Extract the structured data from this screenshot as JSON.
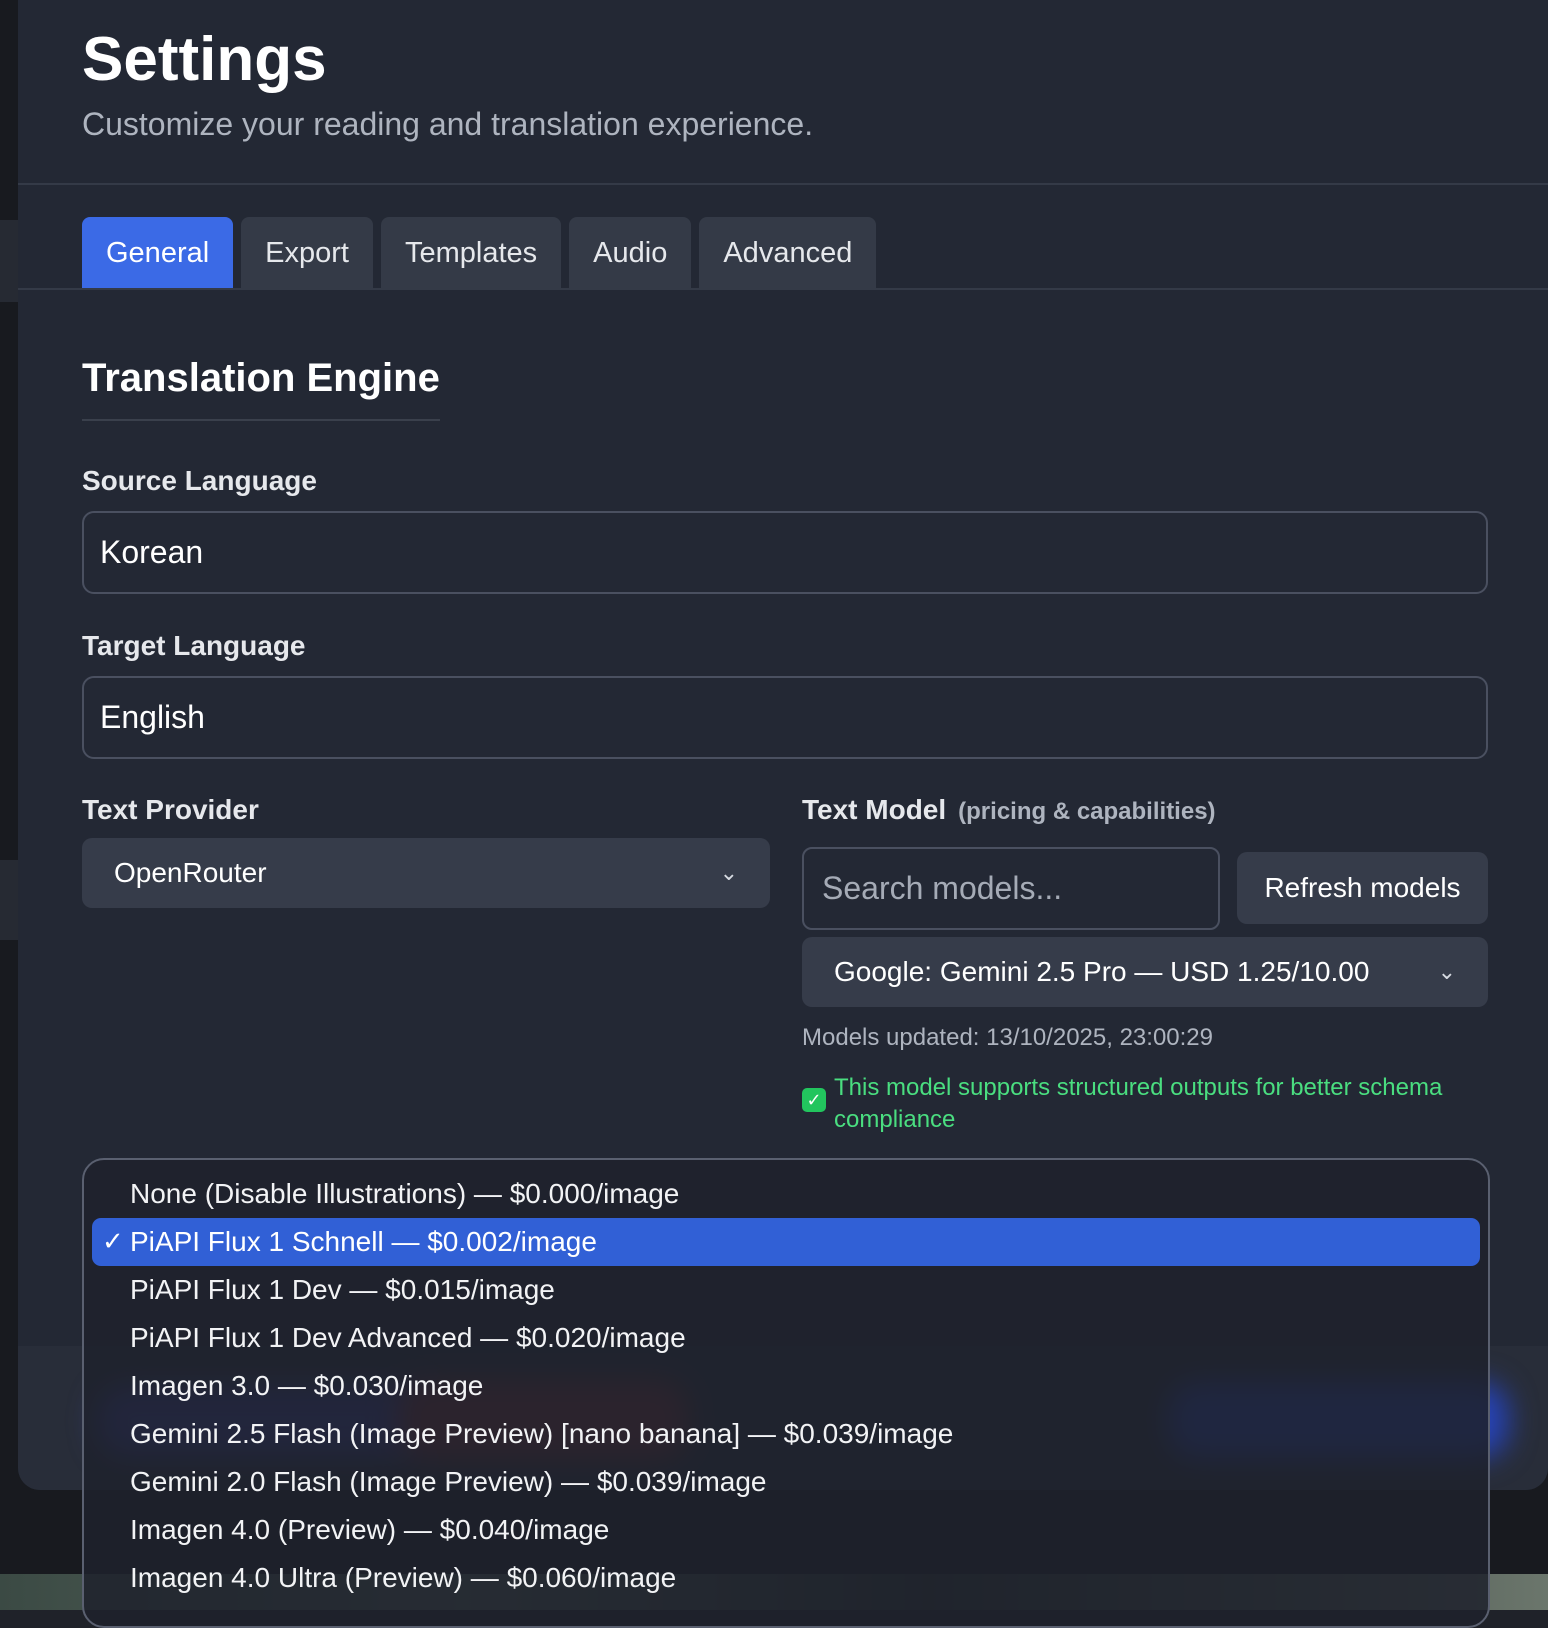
{
  "header": {
    "title": "Settings",
    "subtitle": "Customize your reading and translation experience."
  },
  "tabs": [
    {
      "label": "General",
      "active": true
    },
    {
      "label": "Export",
      "active": false
    },
    {
      "label": "Templates",
      "active": false
    },
    {
      "label": "Audio",
      "active": false
    },
    {
      "label": "Advanced",
      "active": false
    }
  ],
  "section": {
    "title": "Translation Engine"
  },
  "source_language": {
    "label": "Source Language",
    "value": "Korean"
  },
  "target_language": {
    "label": "Target Language",
    "value": "English"
  },
  "text_provider": {
    "label": "Text Provider",
    "value": "OpenRouter"
  },
  "text_model": {
    "label": "Text Model",
    "hint": "(pricing & capabilities)",
    "search_placeholder": "Search models...",
    "refresh_label": "Refresh models",
    "selected": "Google: Gemini 2.5 Pro — USD 1.25/10.00",
    "updated": "Models updated: 13/10/2025, 23:00:29",
    "support_text": "This model supports structured outputs for better schema compliance",
    "support_icon": "checkmark-icon"
  },
  "image_model_dropdown": {
    "selected_index": 1,
    "options": [
      "None (Disable Illustrations) — $0.000/image",
      "PiAPI Flux 1 Schnell — $0.002/image",
      "PiAPI Flux 1 Dev — $0.015/image",
      "PiAPI Flux 1 Dev Advanced — $0.020/image",
      "Imagen 3.0 — $0.030/image",
      "Gemini 2.5 Flash (Image Preview) [nano banana] — $0.039/image",
      "Gemini 2.0 Flash (Image Preview) — $0.039/image",
      "Imagen 4.0 (Preview) — $0.040/image",
      "Imagen 4.0 Ultra (Preview) — $0.060/image"
    ]
  },
  "colors": {
    "accent": "#3b6ae6",
    "selected_option": "#3160d6",
    "success": "#4ade80",
    "modal_bg": "#232834"
  }
}
